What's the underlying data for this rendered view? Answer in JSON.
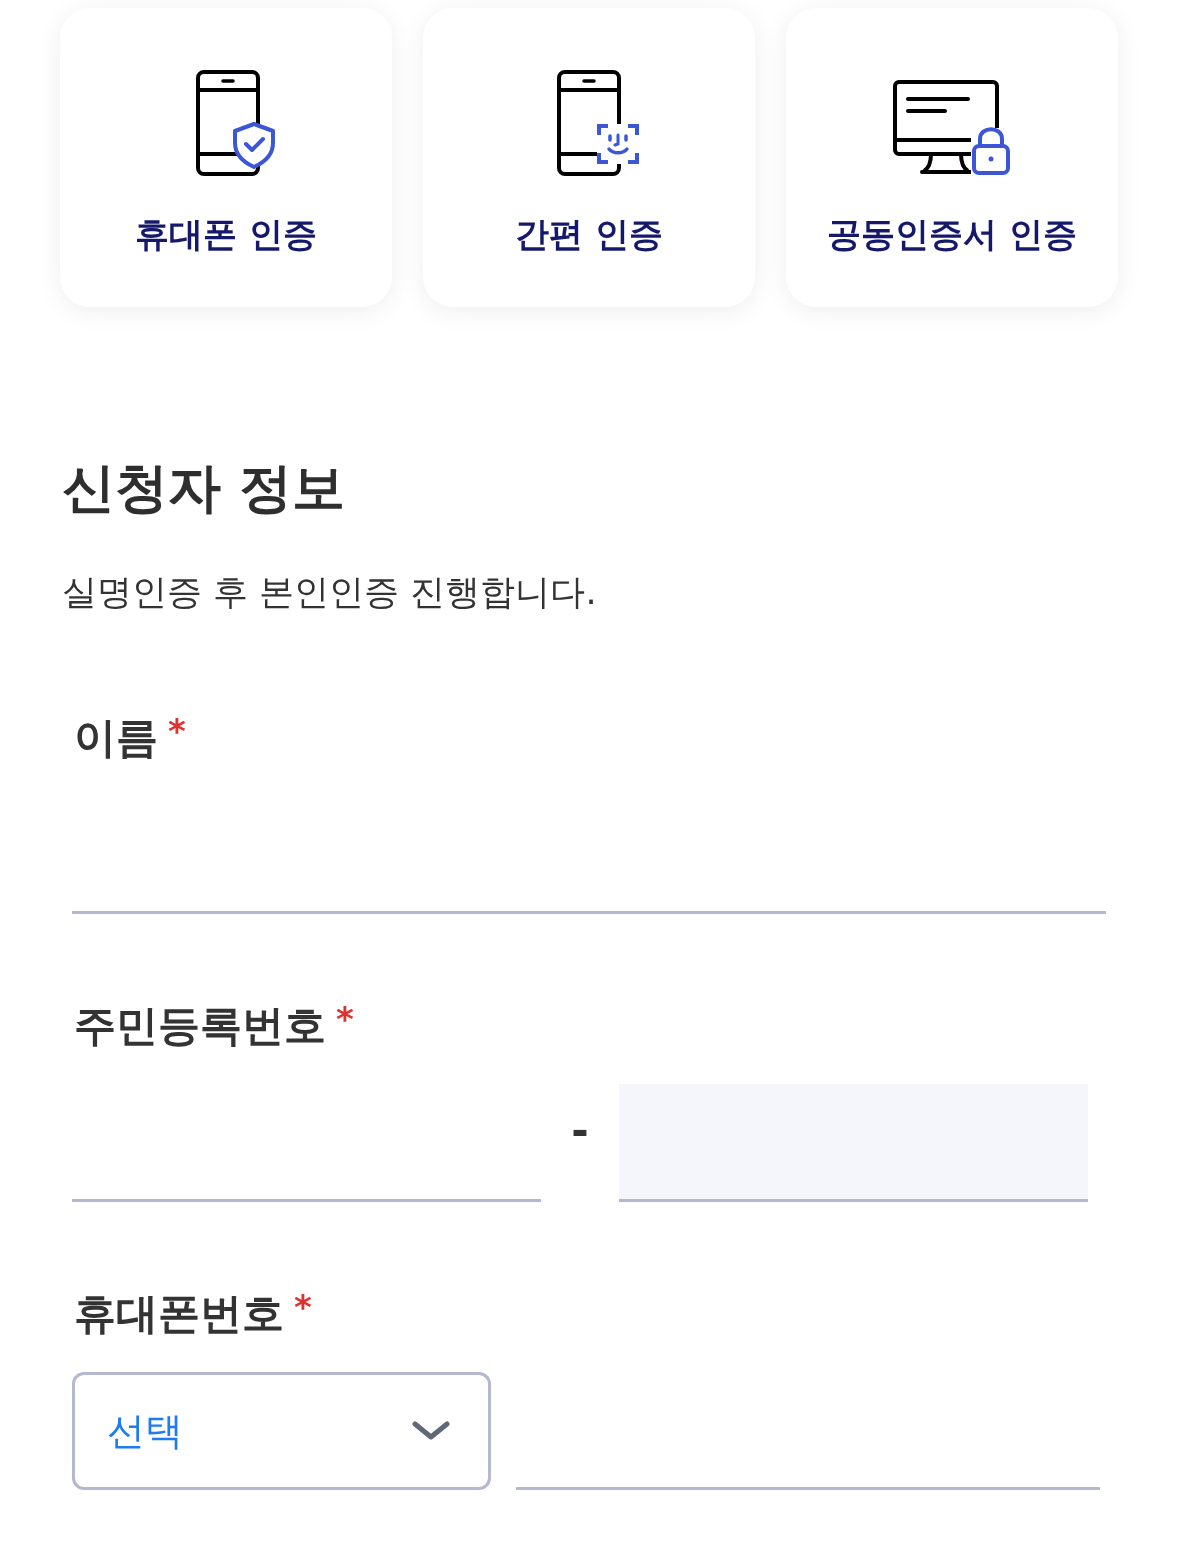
{
  "auth_methods": [
    {
      "kind": "phone",
      "label": "휴대폰 인증"
    },
    {
      "kind": "simple",
      "label": "간편 인증"
    },
    {
      "kind": "certificate",
      "label": "공동인증서 인증"
    }
  ],
  "section": {
    "title": "신청자 정보",
    "description": "실명인증 후 본인인증 진행합니다."
  },
  "fields": [
    {
      "kind": "text",
      "label": "이름",
      "required_mark": "*"
    },
    {
      "kind": "rrn",
      "label": "주민등록번호",
      "required_mark": "*",
      "separator": "-",
      "inputs": [
        {
          "kind": "plain"
        },
        {
          "kind": "shaded"
        }
      ]
    },
    {
      "kind": "phone",
      "label": "휴대폰번호",
      "required_mark": "*",
      "select": {
        "value": "선택"
      }
    }
  ]
}
